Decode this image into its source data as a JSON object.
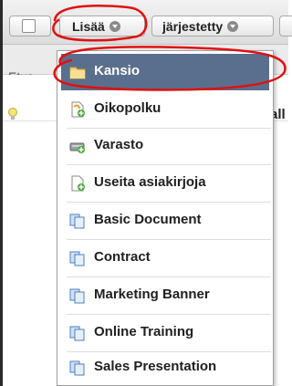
{
  "toolbar": {
    "add_label": "Lisää",
    "sort_label": "järjestetty"
  },
  "list": {
    "header_partial": "Etus",
    "row_partial": "all"
  },
  "menu": {
    "items": [
      {
        "label": "Kansio",
        "icon": "folder-icon"
      },
      {
        "label": "Oikopolku",
        "icon": "shortcut-icon"
      },
      {
        "label": "Varasto",
        "icon": "storage-icon"
      },
      {
        "label": "Useita asiakirjoja",
        "icon": "multiple-documents-icon"
      },
      {
        "label": "Basic Document",
        "icon": "template-document-icon"
      },
      {
        "label": "Contract",
        "icon": "template-document-icon"
      },
      {
        "label": "Marketing Banner",
        "icon": "template-document-icon"
      },
      {
        "label": "Online Training",
        "icon": "template-document-icon"
      },
      {
        "label": "Sales Presentation",
        "icon": "template-document-icon"
      }
    ]
  },
  "colors": {
    "active_item_bg": "#5a6f8d",
    "annotation": "#e01010"
  }
}
